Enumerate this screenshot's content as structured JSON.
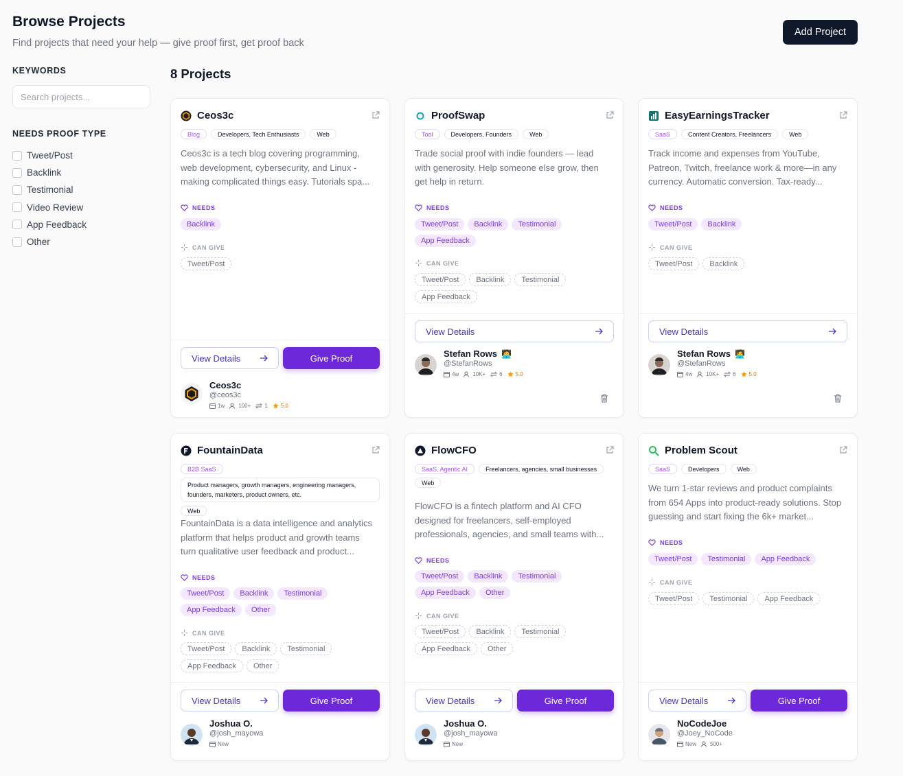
{
  "header": {
    "title": "Browse Projects",
    "subtitle": "Find projects that need your help — give proof first, get proof back",
    "add_label": "Add Project"
  },
  "sidebar": {
    "keywords_heading": "KEYWORDS",
    "search_placeholder": "Search projects...",
    "filter_heading": "NEEDS PROOF TYPE",
    "filters": [
      "Tweet/Post",
      "Backlink",
      "Testimonial",
      "Video Review",
      "App Feedback",
      "Other"
    ]
  },
  "count_label": "8 Projects",
  "labels": {
    "needs": "NEEDS",
    "can_give": "CAN GIVE",
    "view_details": "View Details",
    "give_proof": "Give Proof"
  },
  "projects": [
    {
      "name": "Ceos3c",
      "icon": "ceos3c-logo-icon",
      "category": "Blog",
      "audience": "Developers, Tech Enthusiasts",
      "platform": "Web",
      "description": "Ceos3c is a tech blog covering programming, web development, cybersecurity, and Linux - making complicated things easy. Tutorials spa...",
      "needs": [
        "Backlink"
      ],
      "can_give": [
        "Tweet/Post"
      ],
      "owner": {
        "name": "Ceos3c",
        "handle": "@ceos3c",
        "age": "1w",
        "followers": "100+",
        "swaps": "1",
        "rating": "5.0"
      }
    },
    {
      "name": "ProofSwap",
      "icon": "proofswap-logo-icon",
      "category": "Tool",
      "audience": "Developers, Founders",
      "platform": "Web",
      "description": "Trade social proof with indie founders — lead with generosity. Help someone else grow, then get help in return.",
      "needs": [
        "Tweet/Post",
        "Backlink",
        "Testimonial",
        "App Feedback"
      ],
      "can_give": [
        "Tweet/Post",
        "Backlink",
        "Testimonial",
        "App Feedback"
      ],
      "owner": {
        "name": "Stefan Rows",
        "handle": "@StefanRows",
        "age": "4w",
        "followers": "10K+",
        "swaps": "6",
        "rating": "5.0"
      }
    },
    {
      "name": "EasyEarningsTracker",
      "icon": "chart-logo-icon",
      "category": "SaaS",
      "audience": "Content Creators, Freelancers",
      "platform": "Web",
      "description": "Track income and expenses from YouTube, Patreon, Twitch, freelance work & more—in any currency. Automatic conversion. Tax-ready...",
      "needs": [
        "Tweet/Post",
        "Backlink"
      ],
      "can_give": [
        "Tweet/Post",
        "Backlink"
      ],
      "owner": {
        "name": "Stefan Rows",
        "handle": "@StefanRows",
        "age": "4w",
        "followers": "10K+",
        "swaps": "6",
        "rating": "5.0"
      }
    },
    {
      "name": "FountainData",
      "icon": "fountaindata-logo-icon",
      "category": "B2B SaaS",
      "audience": "Product managers, growth managers, engineering managers, founders, marketers, product owners, etc.",
      "platform": "Web",
      "description": "FountainData is a data intelligence and analytics platform that helps product and growth teams turn qualitative user feedback and product...",
      "needs": [
        "Tweet/Post",
        "Backlink",
        "Testimonial",
        "App Feedback",
        "Other"
      ],
      "can_give": [
        "Tweet/Post",
        "Backlink",
        "Testimonial",
        "App Feedback",
        "Other"
      ],
      "owner": {
        "name": "Joshua O.",
        "handle": "@josh_mayowa",
        "age": "New"
      }
    },
    {
      "name": "FlowCFO",
      "icon": "flowcfo-logo-icon",
      "category": "SaaS, Agentic AI",
      "audience": "Freelancers, agencies, small businesses",
      "platform": "Web",
      "description": "FlowCFO is a fintech platform and AI CFO designed for freelancers, self-employed professionals, agencies, and small teams with...",
      "needs": [
        "Tweet/Post",
        "Backlink",
        "Testimonial",
        "App Feedback",
        "Other"
      ],
      "can_give": [
        "Tweet/Post",
        "Backlink",
        "Testimonial",
        "App Feedback",
        "Other"
      ],
      "owner": {
        "name": "Joshua O.",
        "handle": "@josh_mayowa",
        "age": "New"
      }
    },
    {
      "name": "Problem Scout",
      "icon": "magnifier-logo-icon",
      "category": "SaaS",
      "audience": "Developers",
      "platform": "Web",
      "description": "We turn 1-star reviews and product complaints from 654 Apps into product-ready solutions. Stop guessing and start fixing the 6k+ market...",
      "needs": [
        "Tweet/Post",
        "Testimonial",
        "App Feedback"
      ],
      "can_give": [
        "Tweet/Post",
        "Testimonial",
        "App Feedback"
      ],
      "owner": {
        "name": "NoCodeJoe",
        "handle": "@Joey_NoCode",
        "age": "New",
        "followers": "500+"
      }
    }
  ],
  "colors": {
    "accent": "#6d28d9",
    "dark": "#0f172a",
    "need_bg": "#f3e8ff",
    "star": "#f59e0b"
  }
}
